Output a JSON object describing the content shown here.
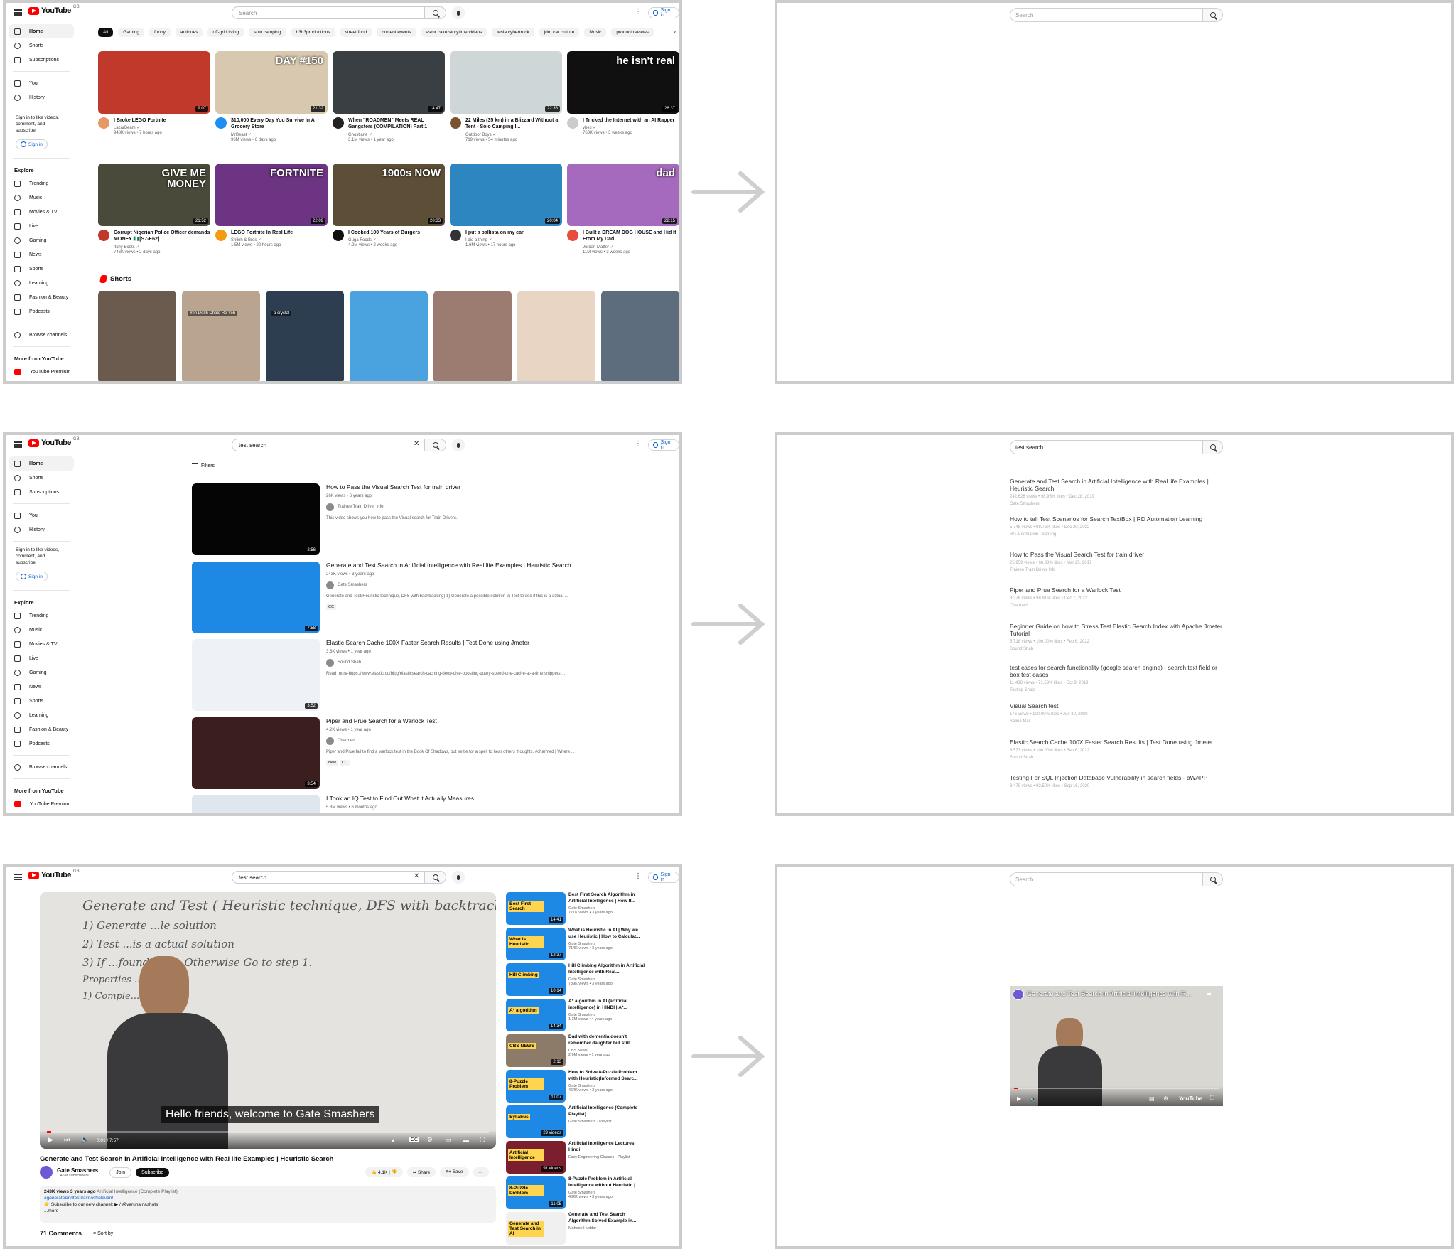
{
  "colors": {
    "yt_red": "#ff0000",
    "link_blue": "#065fd4",
    "panel_border": "#cccccc",
    "arrow": "#cfcfcf"
  },
  "yt": {
    "logo": "YouTube",
    "region": "GB",
    "search_placeholder": "Search",
    "search_query": "test search",
    "sign_in": "Sign in"
  },
  "sidebar": {
    "main": [
      "Home",
      "Shorts",
      "Subscriptions"
    ],
    "you": [
      "You",
      "History"
    ],
    "note": "Sign in to like videos, comment, and subscribe.",
    "sign_in": "Sign in",
    "explore_head": "Explore",
    "explore": [
      "Trending",
      "Music",
      "Movies & TV",
      "Live",
      "Gaming",
      "News",
      "Sports",
      "Learning",
      "Fashion & Beauty",
      "Podcasts"
    ],
    "browse": "Browse channels",
    "more_head": "More from YouTube",
    "more": [
      "YouTube Premium",
      "YouTube Music"
    ]
  },
  "chips": [
    "All",
    "Gaming",
    "funny",
    "antiques",
    "off-grid living",
    "solo camping",
    "h3h3productions",
    "street food",
    "current events",
    "asmr cake storytime videos",
    "tesla cybertruck",
    "jdm car culture",
    "Music",
    "product reviews"
  ],
  "home_videos": [
    {
      "title": "I Broke LEGO Fortnite",
      "channel": "LazarBeam",
      "stats": "948K views • 7 hours ago",
      "duration": "9:07",
      "bg": "#c0392b",
      "av": "#e59866",
      "overlay": ""
    },
    {
      "title": "$10,000 Every Day You Survive In A Grocery Store",
      "channel": "MrBeast",
      "stats": "96M views • 6 days ago",
      "duration": "21:32",
      "bg": "#d9c8b0",
      "av": "#1f8ef1",
      "overlay": "DAY #150"
    },
    {
      "title": "When \"ROADMEN\" Meets REAL Gangsters (COMPILATION) Part 1",
      "channel": "Ghostlane",
      "stats": "3.1M views • 1 year ago",
      "duration": "14:47",
      "bg": "#3a3f44",
      "av": "#222222",
      "overlay": ""
    },
    {
      "title": "22 Miles (35 km) in a Blizzard Without a Tent - Solo Camping I...",
      "channel": "Outdoor Boys",
      "stats": "719 views • 54 minutes ago",
      "duration": "22:36",
      "bg": "#cfd6d8",
      "av": "#7a5230",
      "overlay": ""
    },
    {
      "title": "I Tricked the Internet with an AI Rapper",
      "channel": "ybes",
      "stats": "763K views • 3 weeks ago",
      "duration": "26:37",
      "bg": "#101010",
      "av": "#cccccc",
      "overlay": "he isn't real"
    },
    {
      "title": "Corrupt Nigerian Police Officer demands MONEY 🇳🇬[S7-E62]",
      "channel": "Itchy Boots",
      "stats": "746K views • 2 days ago",
      "duration": "21:52",
      "bg": "#4a4a3a",
      "av": "#c0392b",
      "overlay": "GIVE ME MONEY"
    },
    {
      "title": "LEGO Fortnite In Real Life",
      "channel": "Shiloh & Bros",
      "stats": "1.5M views • 22 hours ago",
      "duration": "22:09",
      "bg": "#6c3483",
      "av": "#f39c12",
      "overlay": "FORTNITE"
    },
    {
      "title": "I Cooked 100 Years of Burgers",
      "channel": "Guga Foods",
      "stats": "4.2M views • 2 weeks ago",
      "duration": "20:33",
      "bg": "#5d4e37",
      "av": "#111111",
      "overlay": "1900s NOW"
    },
    {
      "title": "I put a ballista on my car",
      "channel": "I did a thing",
      "stats": "1.6M views • 17 hours ago",
      "duration": "20:04",
      "bg": "#2e86c1",
      "av": "#333333",
      "overlay": ""
    },
    {
      "title": "I Built a DREAM DOG HOUSE and Hid It From My Dad!",
      "channel": "Jordan Matter",
      "stats": "11M views • 3 weeks ago",
      "duration": "22:15",
      "bg": "#a569bd",
      "av": "#e74c3c",
      "overlay": "dad"
    }
  ],
  "shorts_head": "Shorts",
  "shorts": [
    {
      "bg": "#6b5b4e",
      "caption": ""
    },
    {
      "bg": "#b9a48f",
      "caption": "Yeh Dekh Chalo Re Yeh"
    },
    {
      "bg": "#2c3e50",
      "caption": "a crystal"
    },
    {
      "bg": "#4aa3df",
      "caption": ""
    },
    {
      "bg": "#9c7b70",
      "caption": ""
    },
    {
      "bg": "#e8d5c4",
      "caption": ""
    },
    {
      "bg": "#5d6d7e",
      "caption": ""
    }
  ],
  "search_page": {
    "filters": "Filters",
    "results": [
      {
        "title": "How to Pass the Visual Search Test for train driver",
        "stats": "26K views • 6 years ago",
        "channel": "Trainee Train Driver Info",
        "desc": "This video shows you how to pass the Visual search for Train Drivers.",
        "duration": "2:56",
        "bg": "#050505",
        "badges": []
      },
      {
        "title": "Generate and Test Search in Artificial Intelligence with Real life Examples | Heuristic Search",
        "stats": "243K views • 3 years ago",
        "channel": "Gate Smashers",
        "desc": "Generate and Test(Heuristic technique, DFS with backtracking) 1) Generate a possible solution 2) Test to see if this is a actual ...",
        "duration": "7:58",
        "bg": "#1e88e5",
        "badges": [
          "CC"
        ]
      },
      {
        "title": "Elastic Search Cache 100X Faster Search Results | Test Done using Jmeter",
        "stats": "3.6K views • 1 year ago",
        "channel": "Sound Shah",
        "desc": "Read more-https://www.elastic.co/blog/elasticsearch-caching-deep-dive-boosting-query-speed-one-cache-at-a-time snippets ...",
        "duration": "3:52",
        "bg": "#eef2f6",
        "badges": []
      },
      {
        "title": "Piper and Prue Search for a Warlock Test",
        "stats": "4.2K views • 1 year ago",
        "channel": "Charmed",
        "desc": "Piper and Prue fail to find a warlock test in the Book Of Shadows, but settle for a spell to hear others thoughts. #charmed | Where ...",
        "duration": "3:54",
        "bg": "#3b1f1f",
        "badges": [
          "New",
          "CC"
        ]
      },
      {
        "title": "I Took an IQ Test to Find Out What it Actually Measures",
        "stats": "5.8M views • 6 months ago",
        "channel": "",
        "desc": "",
        "duration": "",
        "bg": "#dfe6ee",
        "badges": []
      }
    ]
  },
  "embed_results": [
    {
      "title": "Generate and Test Search in Artificial Intelligence with Real life Examples | Heuristic Search",
      "stats": "242,626 views • 98.95% likes • Dec 28, 2019",
      "channel": "Gate Smashers"
    },
    {
      "title": "How to tell Test Scenarios for Search TextBox | RD Automation Learning",
      "stats": "5,748 views • 98.75% likes • Dec 20, 2022",
      "channel": "RD Automation Learning"
    },
    {
      "title": "How to Pass the Visual Search Test for train driver",
      "stats": "25,959 views • 66.38% likes • Mar 25, 2017",
      "channel": "Trainee Train Driver Info"
    },
    {
      "title": "Piper and Prue Search for a Warlock Test",
      "stats": "3,376 views • 98.81% likes • Dec 7, 2022",
      "channel": "Charmed"
    },
    {
      "title": "Beginner Guide on how to Stress Test Elastic Search Index with Apache Jmeter Tutorial",
      "stats": "5,718 views • 100.00% likes • Feb 6, 2022",
      "channel": "Sound Shah"
    },
    {
      "title": "test cases for search functionality (google search engine) - search text field or box test cases",
      "stats": "11,438 views • 71.53% likes • Oct 9, 2019",
      "channel": "Testing Shala"
    },
    {
      "title": "Visual Search test",
      "stats": "176 views • 100.00% likes • Jun 30, 2020",
      "channel": "Selina Mai"
    },
    {
      "title": "Elastic Search Cache 100X Faster Search Results | Test Done using Jmeter",
      "stats": "3,573 views • 100.00% likes • Feb 6, 2022",
      "channel": "Sound Shah"
    },
    {
      "title": "Testing For SQL Injection Database Vulnerability in search fields - bWAPP",
      "stats": "3,479 views • 92.50% likes • Sep 16, 2020",
      "channel": ""
    }
  ],
  "watch": {
    "board_lines": [
      "Generate and Test ( Heuristic technique, DFS with backtracking)",
      "1) Generate ...le solution",
      "2) Test ...is a actual solution",
      "3) If ...found, quit. Otherwise Go to step 1.",
      "Properties ...enerators",
      "1) Comple..."
    ],
    "caption": "Hello friends, welcome to Gate Smashers",
    "time": "0:01 / 7:57",
    "progress": 0.01,
    "title": "Generate and Test Search in Artificial Intelligence with Real life Examples | Heuristic Search",
    "channel": "Gate Smashers",
    "subs": "1.46M subscribers",
    "join": "Join",
    "subscribe": "Subscribe",
    "likes": "4.1K",
    "share": "Share",
    "save": "Save",
    "desc_stats": "243K views  3 years ago",
    "desc_playlist": "Artificial Intelligence (Complete Playlist)",
    "desc_hash": "#generateAndtest#aimostrelevant",
    "desc_line": "👉 Subscribe to our new channel: ▶ / @varunainashots",
    "desc_more": "...more",
    "comments": "71 Comments",
    "sort": "Sort by",
    "recs": [
      {
        "title": "Best First Search Algorithm in Artificial Intelligence | How It...",
        "channel": "Gate Smashers",
        "stats": "771K views • 3 years ago",
        "duration": "14:41",
        "bg": "#1e88e5",
        "label": "Best First Search"
      },
      {
        "title": "What is Heuristic in AI | Why we use Heuristic | How to Calculat...",
        "channel": "Gate Smashers",
        "stats": "714K views • 3 years ago",
        "duration": "12:37",
        "bg": "#1e88e5",
        "label": "What is Heuristic"
      },
      {
        "title": "Hill Climbing Algorithm in Artificial Intelligence with Real...",
        "channel": "Gate Smashers",
        "stats": "789K views • 3 years ago",
        "duration": "10:14",
        "bg": "#1e88e5",
        "label": "Hill Climbing"
      },
      {
        "title": "A* algorithm in AI (artificial intelligence) in HINDI | A*...",
        "channel": "Gate Smashers",
        "stats": "1.3M views • 4 years ago",
        "duration": "14:34",
        "bg": "#1e88e5",
        "label": "A* algorithm"
      },
      {
        "title": "Dad with dementia doesn't remember daughter but still...",
        "channel": "CBS News",
        "stats": "2.6M views • 1 year ago",
        "duration": "2:13",
        "bg": "#8d7b6a",
        "label": "CBS NEWS"
      },
      {
        "title": "How to Solve 8-Puzzle Problem with Heuristic(Informed Searc...",
        "channel": "Gate Smashers",
        "stats": "464K views • 3 years ago",
        "duration": "11:07",
        "bg": "#1e88e5",
        "label": "8-Puzzle Problem"
      },
      {
        "title": "Artificial Intelligence (Complete Playlist)",
        "channel": "Gate Smashers · Playlist",
        "stats": "",
        "duration": "29 videos",
        "bg": "#1e88e5",
        "label": "Syllabus"
      },
      {
        "title": "Artificial Intelligence Lectures Hindi",
        "channel": "Easy Engineering Classes · Playlist",
        "stats": "",
        "duration": "91 videos",
        "bg": "#7b1f2e",
        "label": "Artificial Intelligence"
      },
      {
        "title": "8-Puzzle Problem in Artificial Intelligence without Heuristic |...",
        "channel": "Gate Smashers",
        "stats": "482K views • 3 years ago",
        "duration": "11:05",
        "bg": "#1e88e5",
        "label": "8-Puzzle Problem"
      },
      {
        "title": "Generate and Test Search Algorithm Solved Example in...",
        "channel": "Mahesh Huddar",
        "stats": "",
        "duration": "",
        "bg": "#f0f0f0",
        "label": "Generate and Test Search in AI"
      }
    ]
  },
  "embed_player": {
    "title": "Generate and Test Search in Artificial Intelligence with R...",
    "brand": "YouTube",
    "progress": 0.02
  }
}
